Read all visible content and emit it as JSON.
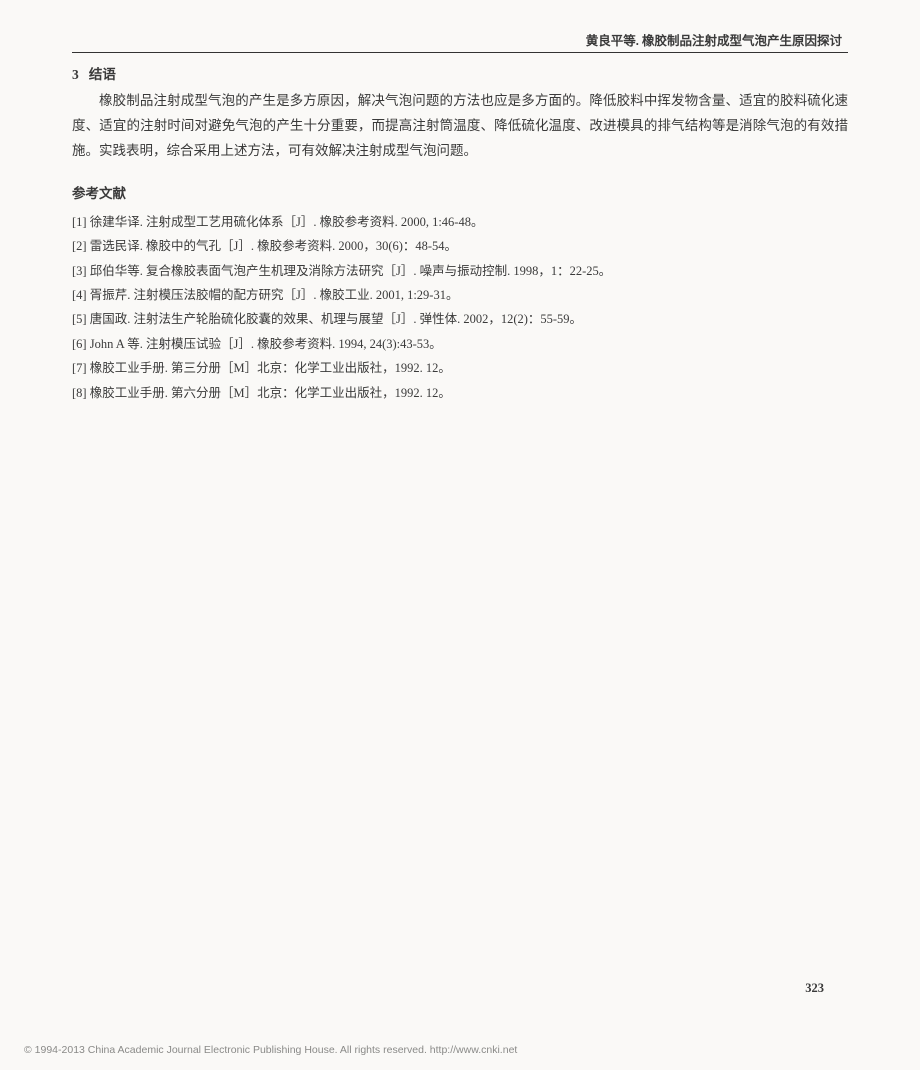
{
  "header": {
    "running_title": "黄良平等. 橡胶制品注射成型气泡产生原因探讨"
  },
  "section": {
    "number": "3",
    "title": "结语",
    "body": "橡胶制品注射成型气泡的产生是多方原因，解决气泡问题的方法也应是多方面的。降低胶料中挥发物含量、适宜的胶料硫化速度、适宜的注射时间对避免气泡的产生十分重要，而提高注射筒温度、降低硫化温度、改进模具的排气结构等是消除气泡的有效措施。实践表明，综合采用上述方法，可有效解决注射成型气泡问题。"
  },
  "references": {
    "heading": "参考文献",
    "items": [
      "[1] 徐建华译. 注射成型工艺用硫化体系［J］. 橡胶参考资料. 2000, 1:46-48。",
      "[2] 雷选民译. 橡胶中的气孔［J］. 橡胶参考资料. 2000，30(6)：48-54。",
      "[3] 邱伯华等. 复合橡胶表面气泡产生机理及消除方法研究［J］. 噪声与振动控制. 1998，1：22-25。",
      "[4] 胥振芹. 注射模压法胶帽的配方研究［J］. 橡胶工业. 2001, 1:29-31。",
      "[5] 唐国政. 注射法生产轮胎硫化胶囊的效果、机理与展望［J］. 弹性体. 2002，12(2)：55-59。",
      "[6] John A 等. 注射模压试验［J］. 橡胶参考资料. 1994, 24(3):43-53。",
      "[7] 橡胶工业手册. 第三分册［M］北京：化学工业出版社，1992. 12。",
      "[8] 橡胶工业手册. 第六分册［M］北京：化学工业出版社，1992. 12。"
    ]
  },
  "page_number": "323",
  "footer": "© 1994-2013 China Academic Journal Electronic Publishing House. All rights reserved.    http://www.cnki.net"
}
